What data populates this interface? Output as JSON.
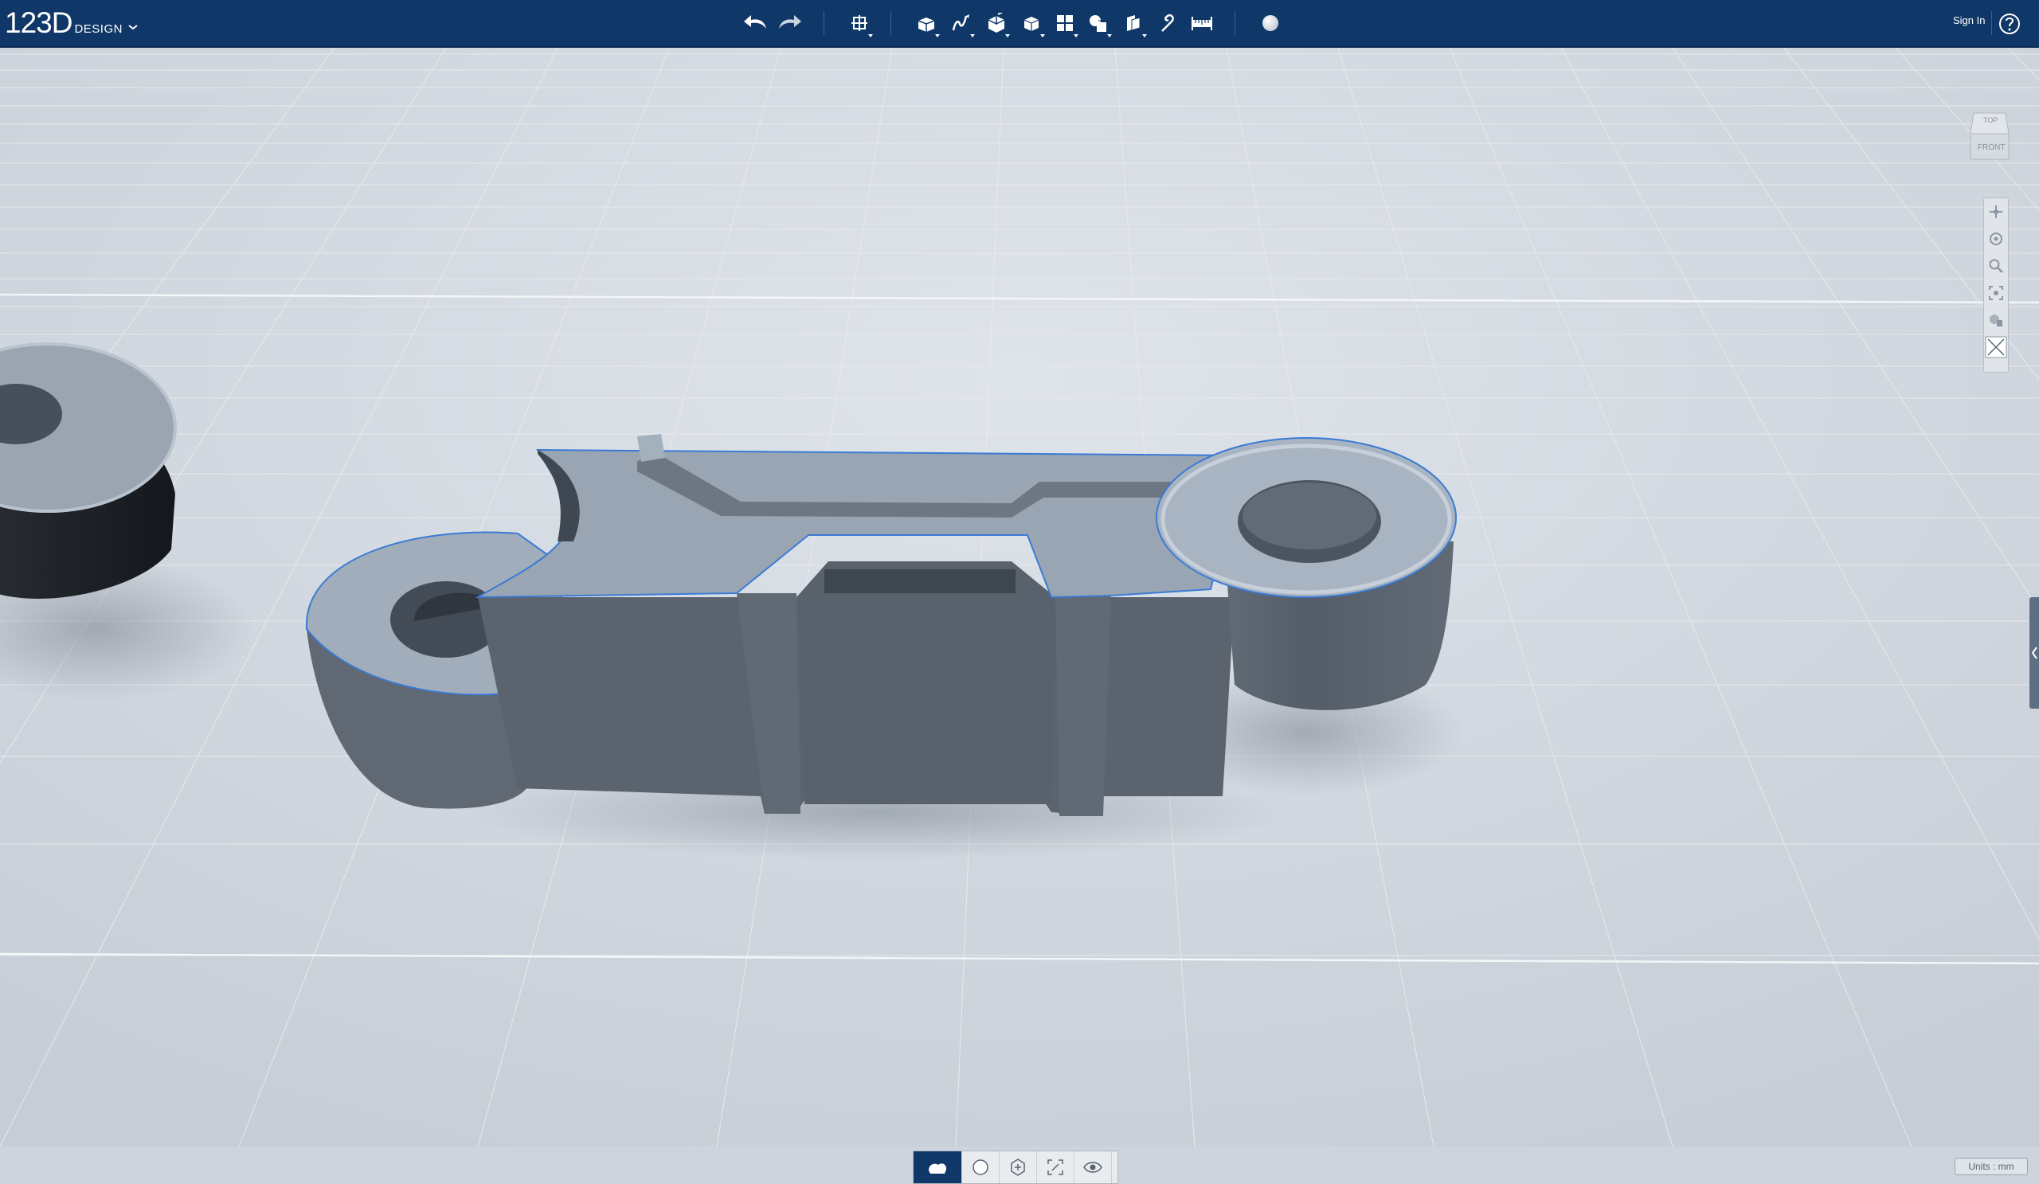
{
  "app": {
    "logo_main": "123D",
    "logo_sub": "DESIGN",
    "menu_icon": "chevron-down-icon"
  },
  "toolbar": {
    "tools": [
      {
        "name": "undo",
        "icon": "undo-icon"
      },
      {
        "name": "redo",
        "icon": "redo-icon"
      },
      {
        "name": "transform",
        "icon": "transform-icon"
      },
      {
        "name": "primitives",
        "icon": "primitives-icon"
      },
      {
        "name": "sketch",
        "icon": "sketch-icon"
      },
      {
        "name": "construct",
        "icon": "construct-icon"
      },
      {
        "name": "modify",
        "icon": "modify-icon"
      },
      {
        "name": "pattern",
        "icon": "pattern-icon"
      },
      {
        "name": "grouping",
        "icon": "grouping-icon"
      },
      {
        "name": "combine",
        "icon": "combine-icon"
      },
      {
        "name": "snap",
        "icon": "snap-icon"
      },
      {
        "name": "measure",
        "icon": "measure-icon"
      },
      {
        "name": "material",
        "icon": "material-sphere-icon"
      }
    ],
    "sign_in": "Sign In",
    "help_icon": "help-icon"
  },
  "viewcube": {
    "top_label": "TOP",
    "front_label": "FRONT"
  },
  "navbar": {
    "items": [
      "pan-icon",
      "orbit-icon",
      "zoom-icon",
      "fit-icon",
      "materials-icon",
      "close-view-icon"
    ]
  },
  "bottombar": {
    "items": [
      "solid-view-icon",
      "shaded-icon",
      "outline-icon",
      "frame-icon",
      "visibility-icon"
    ],
    "active": "solid-view-icon"
  },
  "units": {
    "label": "Units : mm"
  },
  "colors": {
    "toolbar_bg": "#0f3768",
    "viewport_bg": "#cdd4dd",
    "model_face": "#8e9aa7",
    "model_side": "#56606c",
    "selection_outline": "#3a7bd5"
  }
}
